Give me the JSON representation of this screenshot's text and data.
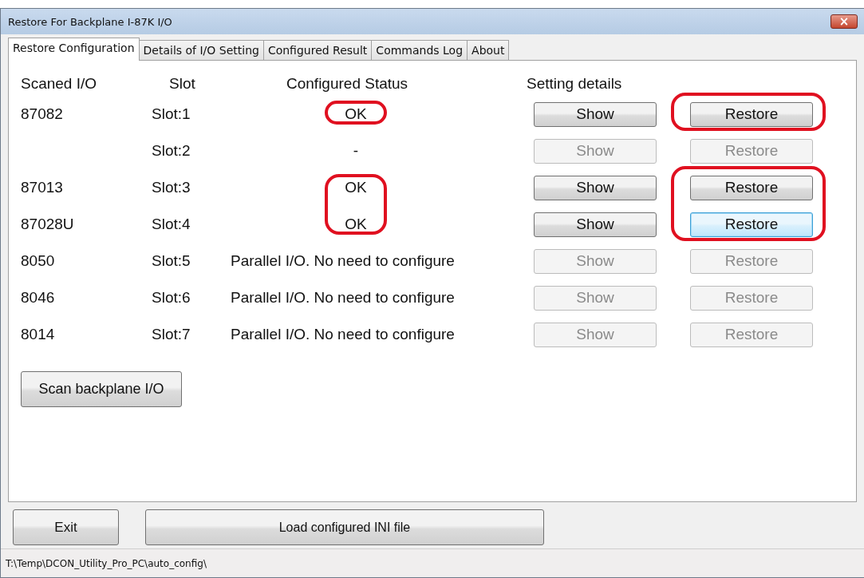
{
  "window": {
    "title": "Restore For Backplane I-87K I/O",
    "close": "×"
  },
  "tabs": [
    {
      "label": "Restore Configuration",
      "selected": true
    },
    {
      "label": "Details of I/O Setting",
      "selected": false
    },
    {
      "label": "Configured Result",
      "selected": false
    },
    {
      "label": "Commands Log",
      "selected": false
    },
    {
      "label": "About",
      "selected": false
    }
  ],
  "table": {
    "columns": [
      "Scaned I/O",
      "Slot",
      "Configured Status",
      "Setting details"
    ],
    "rows": [
      {
        "scanned": "87082",
        "slot": "Slot:1",
        "status": {
          "kind": "ok",
          "text": "OK",
          "circled": true
        },
        "show": {
          "label": "Show",
          "enabled": true
        },
        "restore": {
          "label": "Restore",
          "enabled": true,
          "focused": false,
          "circled": true
        }
      },
      {
        "slot": "Slot:2",
        "status": {
          "kind": "ok",
          "text": "-",
          "circled": false
        },
        "show": {
          "label": "Show",
          "enabled": false
        },
        "restore": {
          "label": "Restore",
          "enabled": false,
          "focused": false,
          "circled": false
        }
      },
      {
        "scanned": "87013",
        "slot": "Slot:3",
        "status": {
          "kind": "ok",
          "text": "OK",
          "circled": true
        },
        "show": {
          "label": "Show",
          "enabled": true
        },
        "restore": {
          "label": "Restore",
          "enabled": true,
          "focused": false,
          "circled": true
        }
      },
      {
        "scanned": "87028U",
        "slot": "Slot:4",
        "status": {
          "kind": "ok",
          "text": "OK",
          "circled": true
        },
        "show": {
          "label": "Show",
          "enabled": true
        },
        "restore": {
          "label": "Restore",
          "enabled": true,
          "focused": true,
          "circled": true
        }
      },
      {
        "scanned": "8050",
        "slot": "Slot:5",
        "status": {
          "kind": "note",
          "text": "Parallel I/O. No need to configure",
          "circled": false
        },
        "show": {
          "label": "Show",
          "enabled": false
        },
        "restore": {
          "label": "Restore",
          "enabled": false,
          "focused": false,
          "circled": false
        }
      },
      {
        "scanned": "8046",
        "slot": "Slot:6",
        "status": {
          "kind": "note",
          "text": "Parallel I/O. No need to configure",
          "circled": false
        },
        "show": {
          "label": "Show",
          "enabled": false
        },
        "restore": {
          "label": "Restore",
          "enabled": false,
          "focused": false,
          "circled": false
        }
      },
      {
        "scanned": "8014",
        "slot": "Slot:7",
        "status": {
          "kind": "note",
          "text": "Parallel I/O. No need to configure",
          "circled": false
        },
        "show": {
          "label": "Show",
          "enabled": false
        },
        "restore": {
          "label": "Restore",
          "enabled": false,
          "focused": false,
          "circled": false
        }
      }
    ]
  },
  "scan_button": "Scan backplane I/O",
  "buttons": [
    "Exit",
    "Load configured INI file"
  ],
  "status_bar": "T:\\Temp\\DCON_Utility_Pro_PC\\auto_config\\"
}
